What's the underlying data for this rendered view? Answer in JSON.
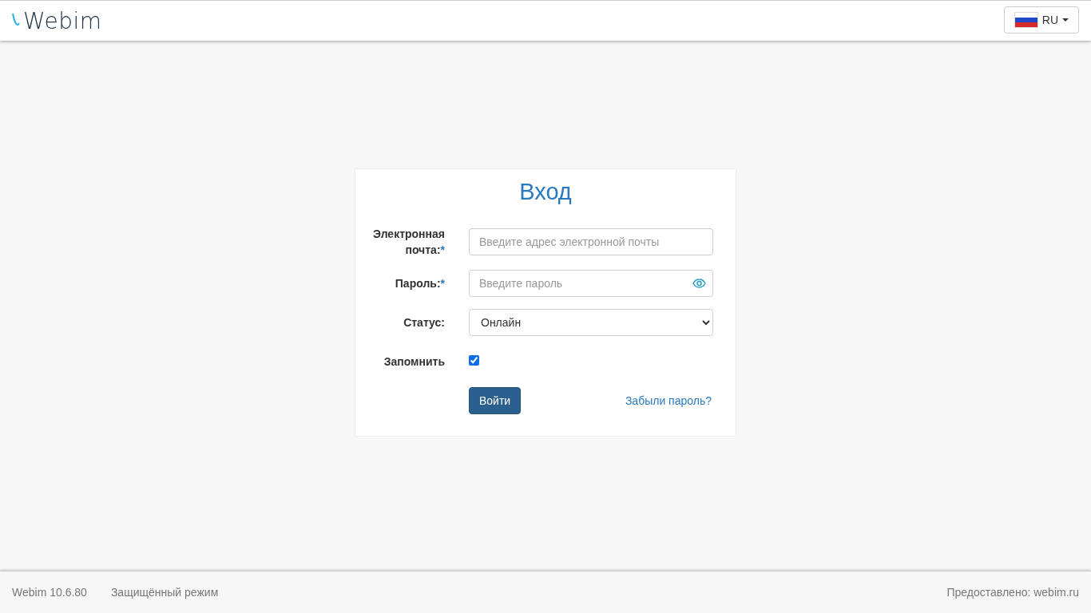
{
  "header": {
    "logo": "Webim",
    "language": {
      "code": "RU"
    }
  },
  "login": {
    "title": "Вход",
    "fields": [
      {
        "kind": "text",
        "label": "Электронная почта:",
        "required_mark": "*",
        "placeholder": "Введите адрес электронной почты"
      },
      {
        "kind": "password",
        "label": "Пароль:",
        "required_mark": "*",
        "placeholder": "Введите пароль"
      },
      {
        "kind": "select",
        "label": "Статус:",
        "value": "Онлайн"
      },
      {
        "kind": "checkbox",
        "label": "Запомнить",
        "checked": true
      }
    ],
    "submit": "Войти",
    "forgot_link": "Забыли пароль?"
  },
  "footer": {
    "version": "Webim 10.6.80",
    "mode": "Защищённый режим",
    "provided_by": "Предоставлено: webim.ru"
  }
}
